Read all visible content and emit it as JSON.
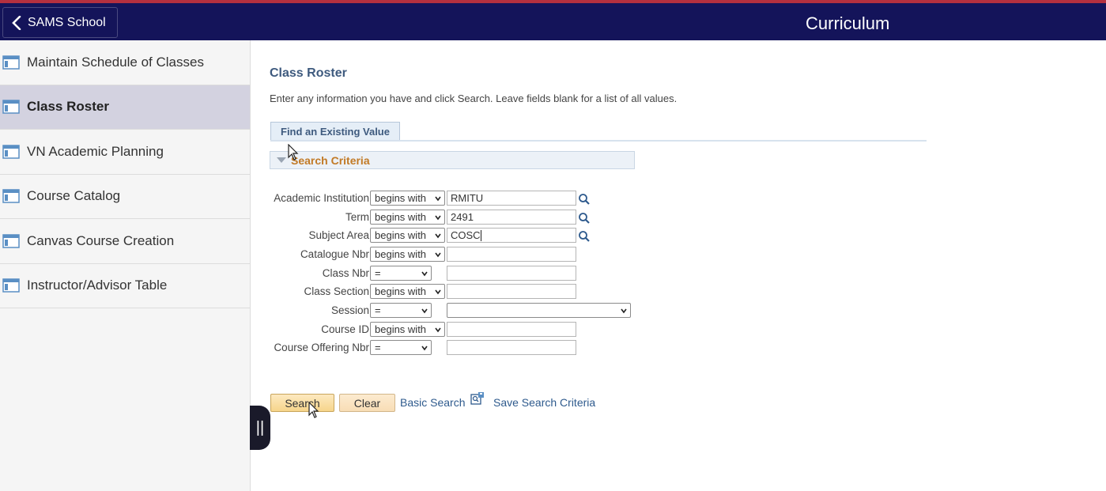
{
  "header": {
    "back_label": "SAMS School",
    "title": "Curriculum"
  },
  "sidebar": {
    "items": [
      {
        "label": "Maintain Schedule of Classes",
        "active": false
      },
      {
        "label": "Class Roster",
        "active": true
      },
      {
        "label": "VN Academic Planning",
        "active": false
      },
      {
        "label": "Course Catalog",
        "active": false
      },
      {
        "label": "Canvas Course Creation",
        "active": false
      },
      {
        "label": "Instructor/Advisor Table",
        "active": false
      }
    ]
  },
  "collapse_handle": "||",
  "main": {
    "title": "Class Roster",
    "instructions": "Enter any information you have and click Search. Leave fields blank for a list of all values.",
    "tab_label": "Find an Existing Value",
    "criteria_label": "Search Criteria",
    "fields": [
      {
        "label": "Academic Institution",
        "operator": "begins with",
        "value": "RMITU",
        "lookup": true
      },
      {
        "label": "Term",
        "operator": "begins with",
        "value": "2491",
        "lookup": true
      },
      {
        "label": "Subject Area",
        "operator": "begins with",
        "value": "COSC",
        "lookup": true
      },
      {
        "label": "Catalogue Nbr",
        "operator": "begins with",
        "value": "",
        "lookup": false
      },
      {
        "label": "Class Nbr",
        "operator": "=",
        "value": "",
        "lookup": false
      },
      {
        "label": "Class Section",
        "operator": "begins with",
        "value": "",
        "lookup": false
      },
      {
        "label": "Session",
        "operator": "=",
        "value": "",
        "lookup": false
      },
      {
        "label": "Course ID",
        "operator": "begins with",
        "value": "",
        "lookup": false
      },
      {
        "label": "Course Offering Nbr",
        "operator": "=",
        "value": "",
        "lookup": false
      }
    ],
    "buttons": {
      "search": "Search",
      "clear": "Clear",
      "basic_search": "Basic Search",
      "save_criteria": "Save Search Criteria"
    }
  },
  "colors": {
    "header_bg": "#14145a",
    "accent_stripe": "#b5303f",
    "active_sidebar": "#d3d2e0",
    "link": "#2e5a8d",
    "criteria_text": "#c27a26"
  }
}
